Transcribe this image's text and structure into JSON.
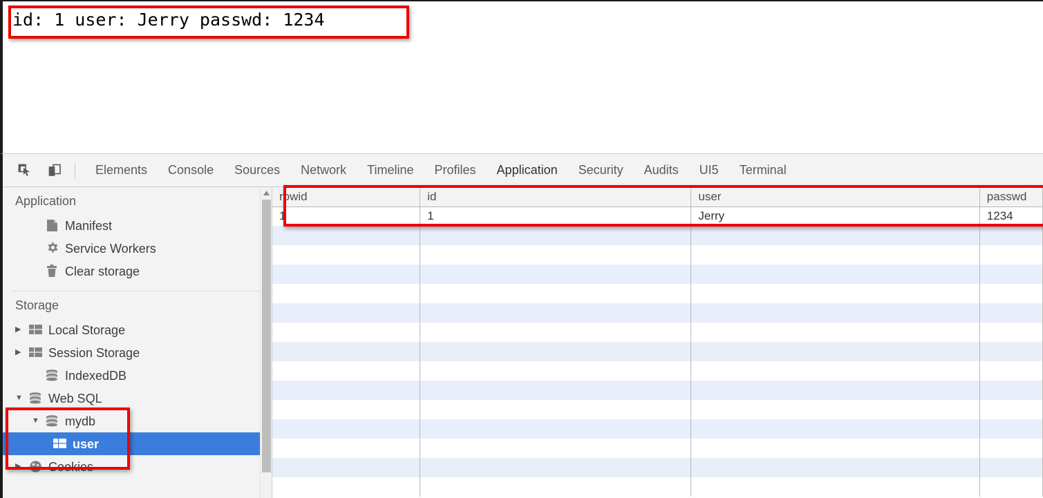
{
  "page": {
    "content_text": "id: 1 user: Jerry passwd: 1234"
  },
  "devtools": {
    "toolbar": {
      "inspect_icon": "inspect-element-icon",
      "device_icon": "device-toolbar-icon"
    },
    "tabs": [
      {
        "label": "Elements",
        "active": false
      },
      {
        "label": "Console",
        "active": false
      },
      {
        "label": "Sources",
        "active": false
      },
      {
        "label": "Network",
        "active": false
      },
      {
        "label": "Timeline",
        "active": false
      },
      {
        "label": "Profiles",
        "active": false
      },
      {
        "label": "Application",
        "active": true
      },
      {
        "label": "Security",
        "active": false
      },
      {
        "label": "Audits",
        "active": false
      },
      {
        "label": "UI5",
        "active": false
      },
      {
        "label": "Terminal",
        "active": false
      }
    ],
    "accent_color": "#4a76d4",
    "selection_color": "#3b7ddd",
    "highlight_color": "#ee0000"
  },
  "sidebar": {
    "sections": [
      {
        "title": "Application",
        "items": [
          {
            "label": "Manifest",
            "icon": "document-icon",
            "arrow": "none",
            "indent": 2,
            "selected": false
          },
          {
            "label": "Service Workers",
            "icon": "gear-icon",
            "arrow": "none",
            "indent": 2,
            "selected": false
          },
          {
            "label": "Clear storage",
            "icon": "trash-icon",
            "arrow": "none",
            "indent": 2,
            "selected": false
          }
        ]
      },
      {
        "title": "Storage",
        "items": [
          {
            "label": "Local Storage",
            "icon": "table-icon",
            "arrow": "collapsed",
            "indent": 1,
            "selected": false
          },
          {
            "label": "Session Storage",
            "icon": "table-icon",
            "arrow": "collapsed",
            "indent": 1,
            "selected": false
          },
          {
            "label": "IndexedDB",
            "icon": "database-icon",
            "arrow": "none",
            "indent": 1,
            "selected": false
          },
          {
            "label": "Web SQL",
            "icon": "database-icon",
            "arrow": "expanded",
            "indent": 1,
            "selected": false
          },
          {
            "label": "mydb",
            "icon": "database-icon",
            "arrow": "expanded",
            "indent": 2,
            "selected": false
          },
          {
            "label": "user",
            "icon": "table-icon",
            "arrow": "none",
            "indent": 3,
            "selected": true
          },
          {
            "label": "Cookies",
            "icon": "cookie-icon",
            "arrow": "collapsed",
            "indent": 1,
            "selected": false
          }
        ]
      }
    ]
  },
  "table": {
    "columns": [
      "rowid",
      "id",
      "user",
      "passwd"
    ],
    "rows": [
      [
        "1",
        "1",
        "Jerry",
        "1234"
      ]
    ],
    "empty_row_count": 14
  }
}
